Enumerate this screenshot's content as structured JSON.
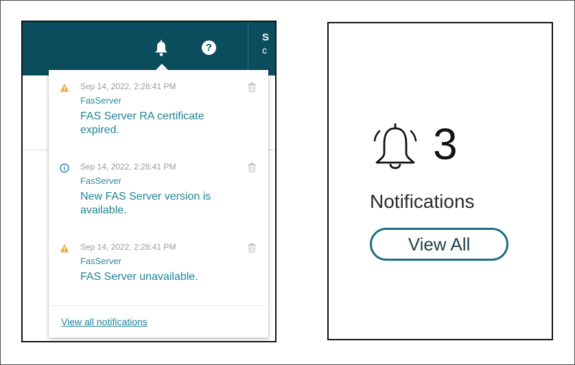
{
  "topbar": {
    "side_title": "S",
    "side_sub": "c"
  },
  "notifications": [
    {
      "status": "warning",
      "timestamp": "Sep 14, 2022, 2:28:41 PM",
      "source": "FasServer",
      "message": "FAS Server RA certificate expired."
    },
    {
      "status": "info",
      "timestamp": "Sep 14, 2022, 2:28:41 PM",
      "source": "FasServer",
      "message": "New FAS Server version is available."
    },
    {
      "status": "warning",
      "timestamp": "Sep 14, 2022, 2:28:41 PM",
      "source": "FasServer",
      "message": "FAS Server unavailable."
    }
  ],
  "dropdown": {
    "view_all_link": "View all notifications"
  },
  "summary": {
    "count": "3",
    "label": "Notifications",
    "view_all_button": "View All"
  },
  "icons": {
    "bell": "bell-icon",
    "help": "help-icon",
    "warning": "warning-icon",
    "info": "info-icon",
    "trash": "trash-icon",
    "ringing_bell": "ringing-bell-icon"
  },
  "colors": {
    "topbar": "#0b4d5c",
    "link": "#1f8397",
    "warning": "#f0a830",
    "info": "#2a7fc0",
    "button_border": "#1b6f80"
  }
}
